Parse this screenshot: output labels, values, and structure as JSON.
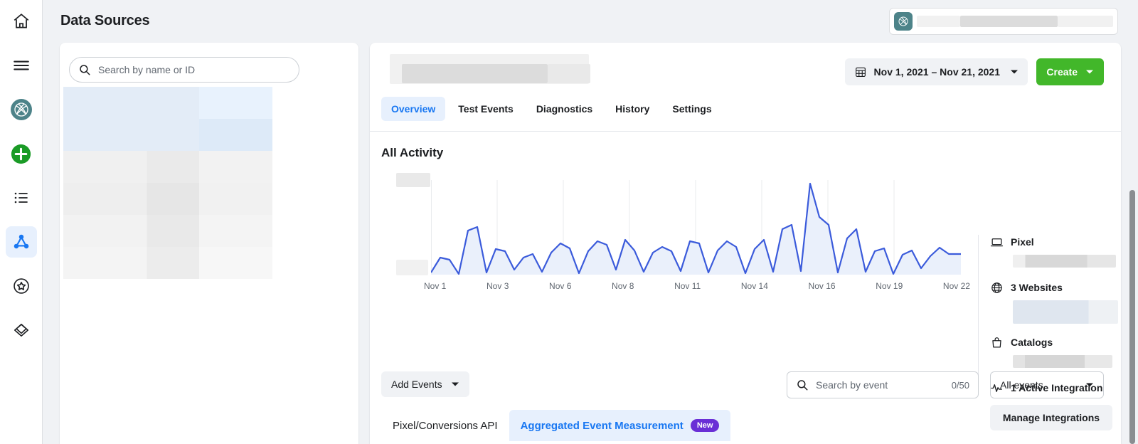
{
  "header": {
    "title": "Data Sources",
    "account_icon": "globe-logo-icon"
  },
  "rail": {
    "items": [
      {
        "name": "home-icon",
        "label": "Home"
      },
      {
        "name": "menu-icon",
        "label": "Menu"
      },
      {
        "name": "business-logo-icon",
        "label": "Business"
      },
      {
        "name": "plus-icon",
        "label": "Create"
      },
      {
        "name": "list-icon",
        "label": "List"
      },
      {
        "name": "data-sources-icon",
        "label": "Data Sources"
      },
      {
        "name": "star-badge-icon",
        "label": "Favorites"
      },
      {
        "name": "diamond-icon",
        "label": "Assets"
      }
    ]
  },
  "list_panel": {
    "search_placeholder": "Search by name or ID",
    "search_icon": "search-icon"
  },
  "main": {
    "date_range": {
      "label": "Nov 1, 2021 – Nov 21, 2021",
      "icon": "calendar-icon"
    },
    "create_button": "Create",
    "tabs": [
      {
        "label": "Overview",
        "active": true
      },
      {
        "label": "Test Events",
        "active": false
      },
      {
        "label": "Diagnostics",
        "active": false
      },
      {
        "label": "History",
        "active": false
      },
      {
        "label": "Settings",
        "active": false
      }
    ],
    "chart_title": "All Activity",
    "info_panel": {
      "rows": [
        {
          "icon": "laptop-icon",
          "label": "Pixel"
        },
        {
          "icon": "globe-icon",
          "label": "3 Websites"
        },
        {
          "icon": "shopping-bag-icon",
          "label": "Catalogs"
        },
        {
          "icon": "pulse-icon",
          "label": "1 Active Integration"
        }
      ],
      "manage_button": "Manage Integrations"
    },
    "toolbar": {
      "add_events": "Add Events",
      "event_search_placeholder": "Search by event",
      "event_search_count": "0/50",
      "event_filter": "All events"
    },
    "subtabs": [
      {
        "label": "Pixel/Conversions API",
        "active": false,
        "badge": ""
      },
      {
        "label": "Aggregated Event Measurement",
        "active": true,
        "badge": "New"
      }
    ]
  },
  "colors": {
    "accent_blue": "#1877f2",
    "chart_line": "#3b5bdb",
    "create_green": "#42b72a",
    "badge_purple": "#6a2fd6",
    "teal_logo": "#4d8389"
  },
  "chart_data": {
    "type": "area",
    "title": "All Activity",
    "xlabel": "",
    "ylabel": "",
    "grid": true,
    "legend_position": "none",
    "axis_labels_redacted": true,
    "tick_labels": [
      "Nov 1",
      "Nov 3",
      "Nov 6",
      "Nov 8",
      "Nov 11",
      "Nov 14",
      "Nov 16",
      "Nov 19",
      "Nov 22"
    ],
    "x": [
      "Nov 1",
      "Nov 2",
      "Nov 3",
      "Nov 4",
      "Nov 5",
      "Nov 6",
      "Nov 7",
      "Nov 8",
      "Nov 9",
      "Nov 10",
      "Nov 11",
      "Nov 12",
      "Nov 13",
      "Nov 14",
      "Nov 15",
      "Nov 16",
      "Nov 17",
      "Nov 18",
      "Nov 19",
      "Nov 20",
      "Nov 21",
      "Nov 22"
    ],
    "series": [
      {
        "name": "All Activity",
        "values": [
          2,
          16,
          13,
          1,
          46,
          42,
          3,
          25,
          22,
          5,
          16,
          19,
          3,
          20,
          29,
          24,
          2,
          22,
          30,
          27,
          5,
          32,
          23,
          4,
          20,
          26,
          22,
          4,
          29,
          27,
          3,
          23,
          30,
          26,
          2,
          24,
          31,
          3,
          48,
          52,
          4,
          96,
          60,
          50,
          3,
          34,
          48,
          4,
          23,
          25,
          2,
          20,
          24,
          6,
          18,
          26,
          20
        ]
      }
    ],
    "ylim": [
      0,
      100
    ],
    "peak": {
      "label": "Nov 16",
      "value": 96
    }
  }
}
